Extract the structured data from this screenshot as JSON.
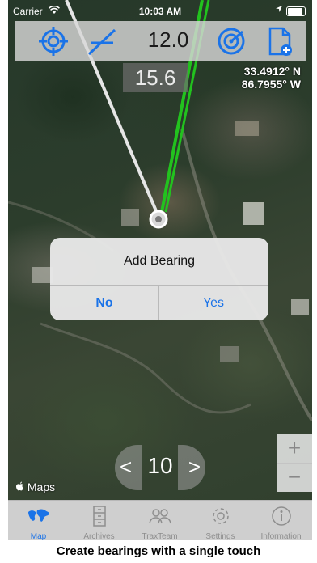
{
  "status_bar": {
    "carrier": "Carrier",
    "time": "10:03 AM"
  },
  "toolbar": {
    "bearing_value": "12.0",
    "secondary_value": "15.6",
    "icons": [
      "crosshair-icon",
      "angle-icon",
      "radar-icon",
      "add-document-icon"
    ],
    "icon_color": "#1a73e8"
  },
  "coordinates": {
    "latitude": "33.4912° N",
    "longitude": "86.7955° W"
  },
  "dialog": {
    "title": "Add Bearing",
    "no_label": "No",
    "yes_label": "Yes"
  },
  "stepper": {
    "value": "10",
    "decrement": "<",
    "increment": ">"
  },
  "zoom": {
    "plus": "+",
    "minus": "−"
  },
  "attribution": "Maps",
  "tabs": [
    {
      "label": "Map",
      "icon": "world-map-icon",
      "active": true
    },
    {
      "label": "Archives",
      "icon": "cabinet-icon",
      "active": false
    },
    {
      "label": "TraxTeam",
      "icon": "team-icon",
      "active": false
    },
    {
      "label": "Settings",
      "icon": "gear-icon",
      "active": false
    },
    {
      "label": "Information",
      "icon": "info-icon",
      "active": false
    }
  ],
  "caption": "Create bearings with a single touch",
  "colors": {
    "accent": "#1a73e8",
    "bearing_line": "#22c21e"
  }
}
